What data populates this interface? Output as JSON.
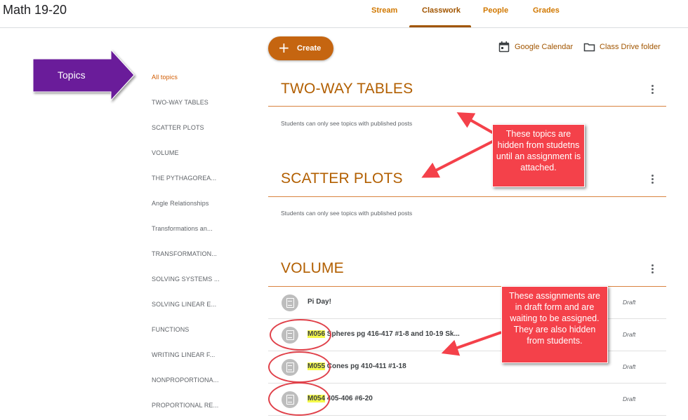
{
  "header": {
    "class_title": "Math 19-20",
    "tabs": [
      {
        "label": "Stream"
      },
      {
        "label": "Classwork"
      },
      {
        "label": "People"
      },
      {
        "label": "Grades"
      }
    ],
    "active_tab": "Classwork"
  },
  "annotations": {
    "topics_arrow_label": "Topics",
    "topics_callout": "These topics are hidden from studetns until an assignment is attached.",
    "assignments_callout": "These assignments are in draft form and are waiting to be assigned.  They are also hidden from students."
  },
  "sidebar": {
    "topics": [
      {
        "label": "All topics",
        "active": true
      },
      {
        "label": "TWO-WAY TABLES"
      },
      {
        "label": "SCATTER PLOTS"
      },
      {
        "label": "VOLUME"
      },
      {
        "label": "THE PYTHAGOREA..."
      },
      {
        "label": "Angle Relationships"
      },
      {
        "label": "Transformations an..."
      },
      {
        "label": "TRANSFORMATION..."
      },
      {
        "label": "SOLVING SYSTEMS ..."
      },
      {
        "label": "SOLVING LINEAR E..."
      },
      {
        "label": "FUNCTIONS"
      },
      {
        "label": "WRITING LINEAR F..."
      },
      {
        "label": "NONPROPORTIONA..."
      },
      {
        "label": "PROPORTIONAL RE..."
      }
    ]
  },
  "toolbar": {
    "create_label": "Create",
    "calendar_label": "Google Calendar",
    "drive_label": "Class Drive folder"
  },
  "sections": [
    {
      "title": "TWO-WAY TABLES",
      "note": "Students can only see topics with published posts"
    },
    {
      "title": "SCATTER PLOTS",
      "note": "Students can only see topics with published posts"
    },
    {
      "title": "VOLUME",
      "note": ""
    }
  ],
  "assignments": [
    {
      "code": "",
      "title": "Pi Day!",
      "status": "Draft"
    },
    {
      "code": "M056",
      "title": " Spheres pg 416-417 #1-8 and 10-19 Sk...",
      "status": "Draft"
    },
    {
      "code": "M055",
      "title": " Cones pg 410-411 #1-18",
      "status": "Draft"
    },
    {
      "code": "M054",
      "title": " 405-406 #6-20",
      "status": "Draft"
    }
  ],
  "colors": {
    "accent": "#a15500",
    "section_title": "#b25f00",
    "create_button": "#c56510",
    "callout": "#f4414a",
    "topics_arrow": "#6a1f9a",
    "highlight": "#f4f94a"
  },
  "icons": [
    "plus-icon",
    "calendar-icon",
    "folder-icon",
    "more-vert-icon",
    "assignment-icon"
  ]
}
